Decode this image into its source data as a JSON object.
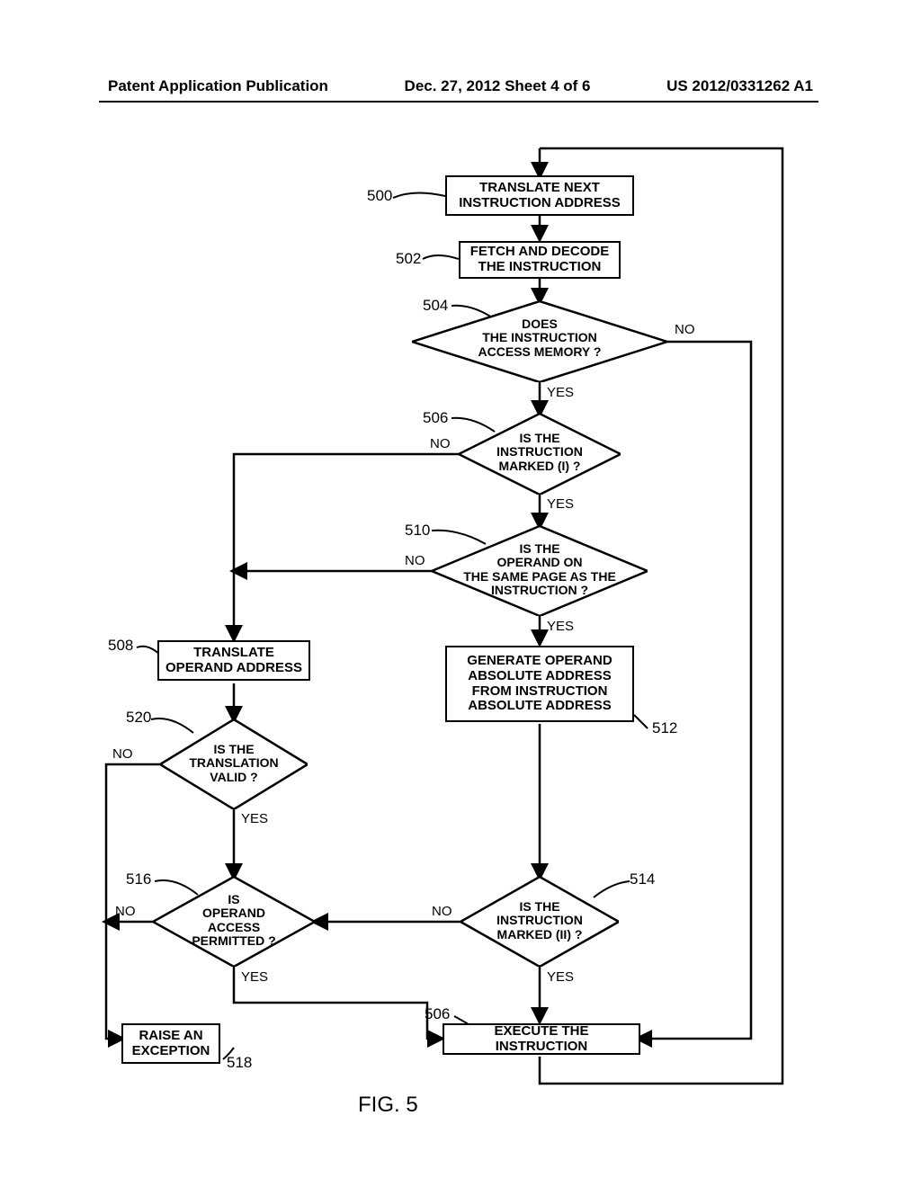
{
  "header": {
    "left": "Patent Application Publication",
    "center": "Dec. 27, 2012  Sheet 4 of 6",
    "right": "US 2012/0331262 A1"
  },
  "figure_label": "FIG. 5",
  "refs": {
    "r500": "500",
    "r502": "502",
    "r504": "504",
    "r506a": "506",
    "r506b": "506",
    "r508": "508",
    "r510": "510",
    "r512": "512",
    "r514": "514",
    "r516": "516",
    "r518": "518",
    "r520": "520"
  },
  "boxes": {
    "b500": "TRANSLATE NEXT\nINSTRUCTION ADDRESS",
    "b502": "FETCH AND DECODE\nTHE INSTRUCTION",
    "b508": "TRANSLATE\nOPERAND ADDRESS",
    "b512": "GENERATE OPERAND\nABSOLUTE ADDRESS\nFROM INSTRUCTION\nABSOLUTE ADDRESS",
    "b518": "RAISE AN\nEXCEPTION",
    "bexec": "EXECUTE THE INSTRUCTION"
  },
  "diamonds": {
    "d504": "DOES\nTHE INSTRUCTION\nACCESS MEMORY ?",
    "d506": "IS THE\nINSTRUCTION\nMARKED (I) ?",
    "d510": "IS THE\nOPERAND ON\nTHE SAME PAGE AS THE\nINSTRUCTION ?",
    "d520": "IS THE\nTRANSLATION\nVALID ?",
    "d516": "IS\nOPERAND\nACCESS\nPERMITTED ?",
    "d514": "IS THE\nINSTRUCTION\nMARKED (II) ?"
  },
  "edges": {
    "yes": "YES",
    "no": "NO"
  }
}
